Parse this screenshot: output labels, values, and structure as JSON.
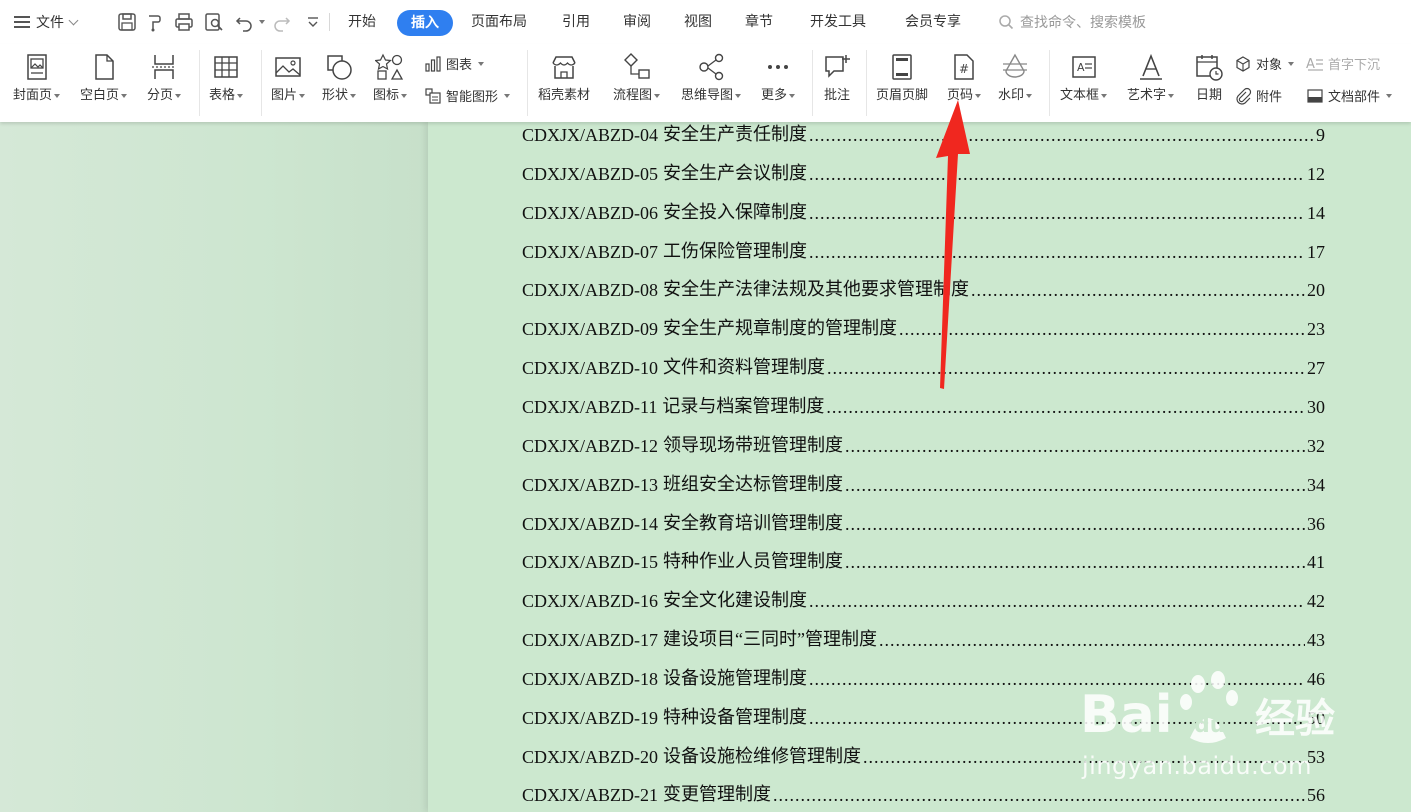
{
  "menubar": {
    "file_label": "文件",
    "tabs": [
      {
        "label": "开始"
      },
      {
        "label": "插入"
      },
      {
        "label": "页面布局"
      },
      {
        "label": "引用"
      },
      {
        "label": "审阅"
      },
      {
        "label": "视图"
      },
      {
        "label": "章节"
      },
      {
        "label": "开发工具"
      },
      {
        "label": "会员专享"
      }
    ],
    "search_placeholder": "查找命令、搜索模板"
  },
  "ribbon": {
    "cover_page": "封面页",
    "blank_page": "空白页",
    "page_break": "分页",
    "table": "表格",
    "picture": "图片",
    "shape": "形状",
    "icon": "图标",
    "chart": "图表",
    "smart_graphic": "智能图形",
    "daoke_material": "稻壳素材",
    "flowchart": "流程图",
    "mindmap": "思维导图",
    "more": "更多",
    "comment": "批注",
    "header_footer": "页眉页脚",
    "page_number": "页码",
    "watermark": "水印",
    "textbox": "文本框",
    "wordart": "艺术字",
    "date": "日期",
    "object": "对象",
    "attachment": "附件",
    "drop_cap": "首字下沉",
    "doc_parts": "文档部件"
  },
  "toc": [
    {
      "code": "CDXJX/ABZD-04",
      "title": "安全生产责任制度",
      "page": "9"
    },
    {
      "code": "CDXJX/ABZD-05",
      "title": "安全生产会议制度",
      "page": "12"
    },
    {
      "code": "CDXJX/ABZD-06",
      "title": "安全投入保障制度",
      "page": "14"
    },
    {
      "code": "CDXJX/ABZD-07",
      "title": "工伤保险管理制度",
      "page": "17"
    },
    {
      "code": "CDXJX/ABZD-08",
      "title": "安全生产法律法规及其他要求管理制度",
      "page": "20"
    },
    {
      "code": "CDXJX/ABZD-09",
      "title": "安全生产规章制度的管理制度",
      "page": "23"
    },
    {
      "code": "CDXJX/ABZD-10",
      "title": "文件和资料管理制度",
      "page": "27"
    },
    {
      "code": "CDXJX/ABZD-11",
      "title": "记录与档案管理制度",
      "page": "30"
    },
    {
      "code": "CDXJX/ABZD-12",
      "title": "领导现场带班管理制度",
      "page": "32"
    },
    {
      "code": "CDXJX/ABZD-13",
      "title": "班组安全达标管理制度",
      "page": "34"
    },
    {
      "code": "CDXJX/ABZD-14",
      "title": "安全教育培训管理制度",
      "page": "36"
    },
    {
      "code": "CDXJX/ABZD-15",
      "title": "特种作业人员管理制度",
      "page": "41"
    },
    {
      "code": "CDXJX/ABZD-16",
      "title": "安全文化建设制度",
      "page": "42"
    },
    {
      "code": "CDXJX/ABZD-17",
      "title": "建设项目“三同时”管理制度",
      "page": "43"
    },
    {
      "code": "CDXJX/ABZD-18",
      "title": "设备设施管理制度",
      "page": "46"
    },
    {
      "code": "CDXJX/ABZD-19",
      "title": "特种设备管理制度",
      "page": "50"
    },
    {
      "code": "CDXJX/ABZD-20",
      "title": "设备设施检维修管理制度",
      "page": "53"
    },
    {
      "code": "CDXJX/ABZD-21",
      "title": "变更管理制度",
      "page": "56"
    }
  ],
  "watermark": {
    "text": "jingyan.baidu.com",
    "logo_text": "Bai du 经验"
  },
  "colors": {
    "accent": "#2f7ff0",
    "page_bg": "#cce8cf",
    "arrow": "#f0271f"
  }
}
